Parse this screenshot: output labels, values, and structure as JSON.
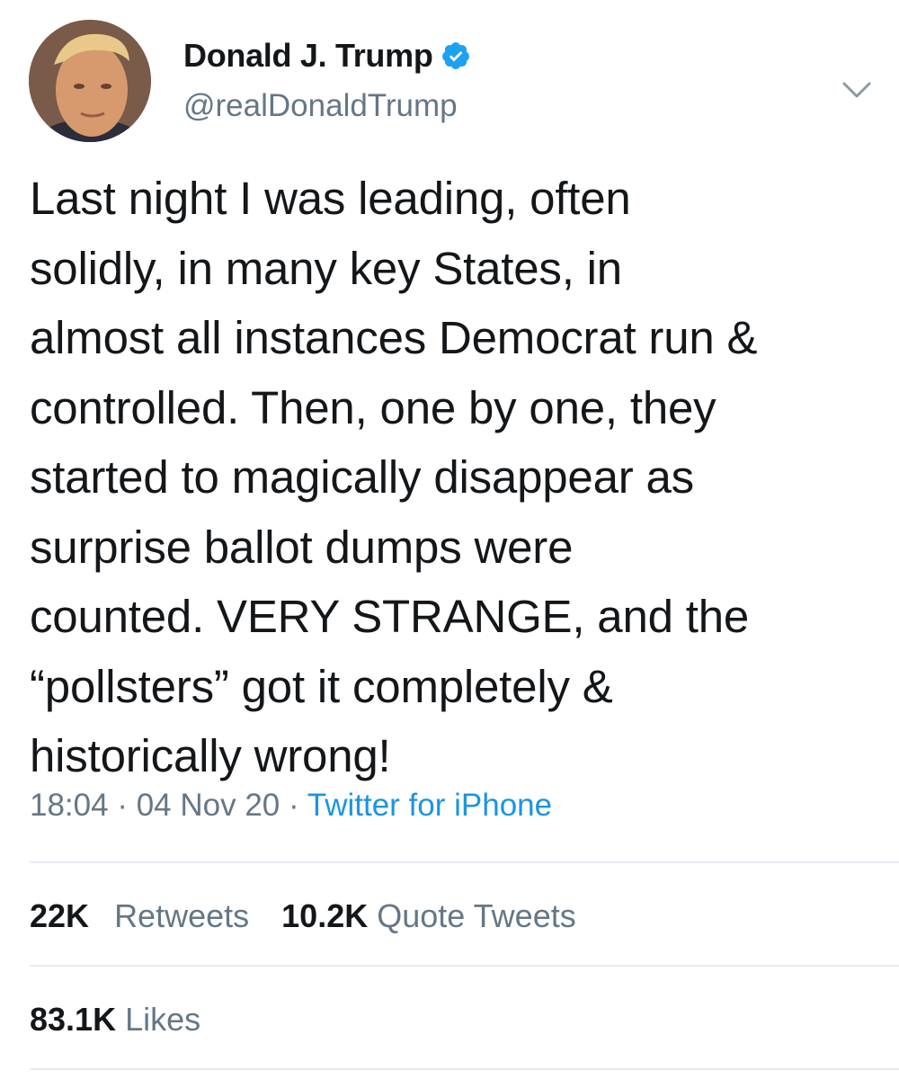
{
  "author": {
    "display_name": "Donald J. Trump",
    "handle": "@realDonaldTrump",
    "verified": true
  },
  "tweet": {
    "text": "Last night I was leading, often\nsolidly, in many key States, in\nalmost all instances Democrat run &\ncontrolled. Then, one by one, they\nstarted to magically disappear as\nsurprise ballot dumps were\ncounted. VERY STRANGE, and the\n“pollsters” got it completely &\nhistorically wrong!",
    "time": "18:04",
    "date": "04 Nov 20",
    "separator": "·",
    "source": "Twitter for iPhone"
  },
  "stats": {
    "retweets_count": "22K",
    "retweets_label": "Retweets",
    "quote_tweets_count": "10.2K",
    "quote_tweets_label": "Quote Tweets",
    "likes_count": "83.1K",
    "likes_label": "Likes"
  },
  "icons": {
    "verified": "verified-badge-icon",
    "menu": "chevron-down-icon"
  },
  "colors": {
    "text": "#14171a",
    "secondary": "#657786",
    "link": "#1b95e0",
    "verified": "#1da1f2",
    "divider": "#e6ecf0"
  }
}
